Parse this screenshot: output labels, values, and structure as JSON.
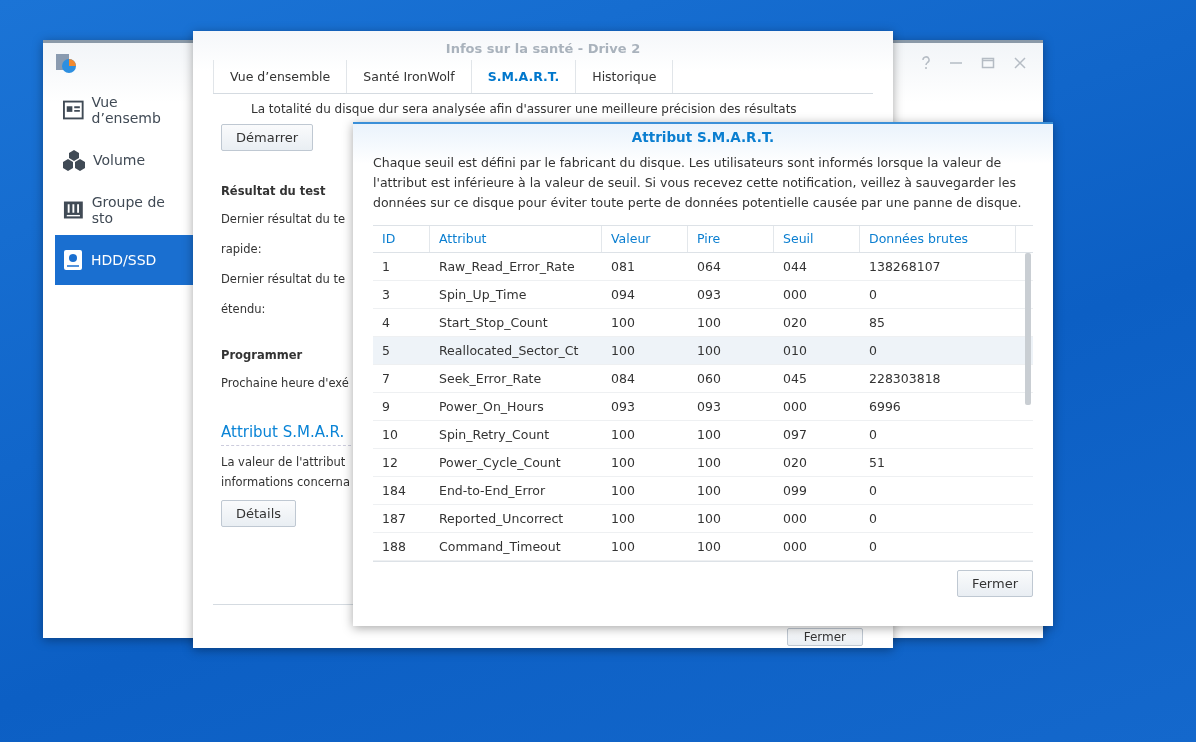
{
  "main_window": {
    "sidebar": {
      "items": [
        {
          "label": "Vue d’ensemb",
          "selected": false
        },
        {
          "label": "Volume",
          "selected": false
        },
        {
          "label": "Groupe de sto",
          "selected": false
        },
        {
          "label": "HDD/SSD",
          "selected": true
        }
      ]
    }
  },
  "health_window": {
    "title": "Infos sur la santé - Drive 2",
    "tabs": [
      {
        "label": "Vue d’ensemble",
        "selected": false
      },
      {
        "label": "Santé IronWolf",
        "selected": false
      },
      {
        "label": "S.M.A.R.T.",
        "selected": true
      },
      {
        "label": "Historique",
        "selected": false
      }
    ],
    "intro": "La totalité du disque dur sera analysée afin d'assurer une meilleure précision des résultats",
    "start_button": "Démarrer",
    "test_heading": "Résultat du test",
    "test_lines": [
      "Dernier résultat du te",
      "rapide:",
      "Dernier résultat du te",
      "étendu:"
    ],
    "schedule_heading": "Programmer",
    "schedule_line": "Prochaine heure d'exé",
    "smart_heading": "Attribut S.M.A.R.",
    "smart_lines": [
      "La valeur de l'attribut",
      "informations concerna"
    ],
    "details_button": "Détails",
    "close_button": "Fermer"
  },
  "dialog": {
    "title": "Attribut S.M.A.R.T.",
    "description": "Chaque seuil est défini par le fabricant du disque. Les utilisateurs sont informés lorsque la valeur de l'attribut est inférieure à la valeur de seuil. Si vous recevez cette notification, veillez à sauvegarder les données sur ce disque pour éviter toute perte de données potentielle causée par une panne de disque.",
    "table": {
      "columns": [
        "ID",
        "Attribut",
        "Valeur",
        "Pire",
        "Seuil",
        "Données brutes"
      ],
      "rows": [
        {
          "cells": [
            "1",
            "Raw_Read_Error_Rate",
            "081",
            "064",
            "044",
            "138268107"
          ],
          "selected": false
        },
        {
          "cells": [
            "3",
            "Spin_Up_Time",
            "094",
            "093",
            "000",
            "0"
          ],
          "selected": false
        },
        {
          "cells": [
            "4",
            "Start_Stop_Count",
            "100",
            "100",
            "020",
            "85"
          ],
          "selected": false
        },
        {
          "cells": [
            "5",
            "Reallocated_Sector_Ct",
            "100",
            "100",
            "010",
            "0"
          ],
          "selected": true
        },
        {
          "cells": [
            "7",
            "Seek_Error_Rate",
            "084",
            "060",
            "045",
            "228303818"
          ],
          "selected": false
        },
        {
          "cells": [
            "9",
            "Power_On_Hours",
            "093",
            "093",
            "000",
            "6996"
          ],
          "selected": false
        },
        {
          "cells": [
            "10",
            "Spin_Retry_Count",
            "100",
            "100",
            "097",
            "0"
          ],
          "selected": false
        },
        {
          "cells": [
            "12",
            "Power_Cycle_Count",
            "100",
            "100",
            "020",
            "51"
          ],
          "selected": false
        },
        {
          "cells": [
            "184",
            "End-to-End_Error",
            "100",
            "100",
            "099",
            "0"
          ],
          "selected": false
        },
        {
          "cells": [
            "187",
            "Reported_Uncorrect",
            "100",
            "100",
            "000",
            "0"
          ],
          "selected": false
        },
        {
          "cells": [
            "188",
            "Command_Timeout",
            "100",
            "100",
            "000",
            "0"
          ],
          "selected": false
        }
      ]
    },
    "close_button": "Fermer"
  }
}
